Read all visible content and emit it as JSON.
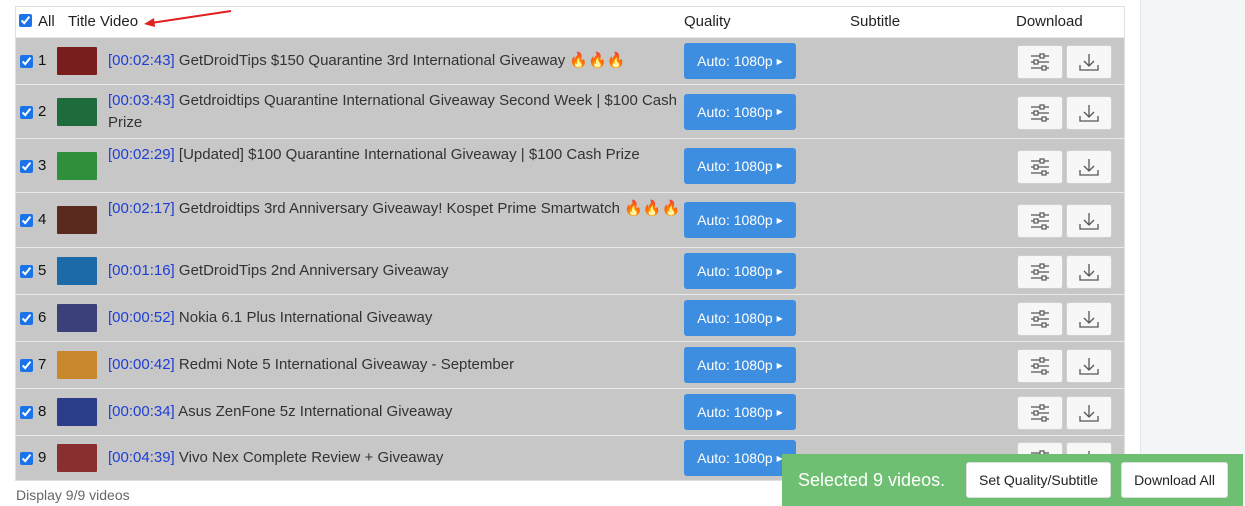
{
  "header": {
    "all_label": "All",
    "title_label": "Title Video",
    "quality_label": "Quality",
    "subtitle_label": "Subtitle",
    "download_label": "Download"
  },
  "rows": [
    {
      "num": "1",
      "duration": "[00:02:43]",
      "title": "GetDroidTips $150 Quarantine 3rd International Giveaway 🔥🔥🔥",
      "quality": "Auto: 1080p",
      "thumb": "#7a1d1d"
    },
    {
      "num": "2",
      "duration": "[00:03:43]",
      "title": "Getdroidtips Quarantine International Giveaway Second Week | $100 Cash Prize",
      "quality": "Auto: 1080p",
      "thumb": "#1e6b3b"
    },
    {
      "num": "3",
      "duration": "[00:02:29]",
      "title": "[Updated] $100 Quarantine International Giveaway | $100 Cash Prize",
      "quality": "Auto: 1080p",
      "thumb": "#2f8f3a"
    },
    {
      "num": "4",
      "duration": "[00:02:17]",
      "title": "Getdroidtips 3rd Anniversary Giveaway! Kospet Prime Smartwatch 🔥🔥🔥",
      "quality": "Auto: 1080p",
      "thumb": "#5a2a1e"
    },
    {
      "num": "5",
      "duration": "[00:01:16]",
      "title": "GetDroidTips 2nd Anniversary Giveaway",
      "quality": "Auto: 1080p",
      "thumb": "#1d6aa8"
    },
    {
      "num": "6",
      "duration": "[00:00:52]",
      "title": "Nokia 6.1 Plus International Giveaway",
      "quality": "Auto: 1080p",
      "thumb": "#3b3f7a"
    },
    {
      "num": "7",
      "duration": "[00:00:42]",
      "title": "Redmi Note 5 International Giveaway - September",
      "quality": "Auto: 1080p",
      "thumb": "#c9872e"
    },
    {
      "num": "8",
      "duration": "[00:00:34]",
      "title": "Asus ZenFone 5z International Giveaway",
      "quality": "Auto: 1080p",
      "thumb": "#2a3e8a"
    },
    {
      "num": "9",
      "duration": "[00:04:39]",
      "title": "Vivo Nex Complete Review + Giveaway",
      "quality": "Auto: 1080p",
      "thumb": "#8a2f2f"
    }
  ],
  "footer": {
    "display_text": "Display 9/9 videos"
  },
  "selection_bar": {
    "text": "Selected 9 videos.",
    "set_quality_label": "Set Quality/Subtitle",
    "download_all_label": "Download All"
  },
  "colors": {
    "row_bg": "#c7c7c7",
    "quality_btn": "#3d8ee0",
    "duration_text": "#1e3ed4",
    "selection_bar": "#6fbf73",
    "annotation_arrow": "#e02020"
  },
  "icons": {
    "settings": "sliders-icon",
    "download": "download-icon"
  }
}
